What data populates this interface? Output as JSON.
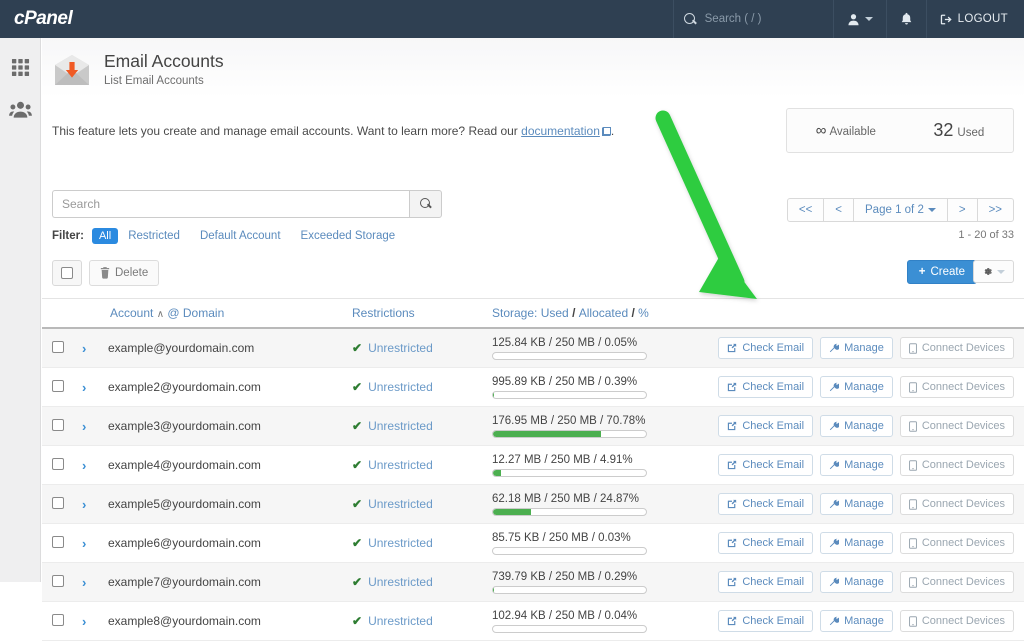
{
  "topbar": {
    "brand": "cPanel",
    "search_placeholder": "Search ( / )",
    "search_value": "",
    "search_icon": "search-icon",
    "user_icon": "user-icon",
    "bell_icon": "bell-icon",
    "logout_label": "LOGOUT",
    "logout_icon": "logout-icon",
    "bg_color": "#2f4052"
  },
  "sidebar": {
    "items": [
      {
        "name": "apps-grid-icon",
        "label": "Apps"
      },
      {
        "name": "users-icon",
        "label": "User Manager"
      }
    ]
  },
  "page": {
    "icon": "email-envelope-icon",
    "title": "Email Accounts",
    "subtitle": "List Email Accounts",
    "intro_prefix": "This feature lets you create and manage email accounts. Want to learn more? Read our ",
    "intro_link": "documentation",
    "intro_suffix": "."
  },
  "quota": {
    "available_value": "∞",
    "available_label": "Available",
    "used_value": "32",
    "used_label": "Used"
  },
  "search": {
    "placeholder": "Search",
    "value": "",
    "button_icon": "search-icon"
  },
  "filter": {
    "label": "Filter:",
    "options": [
      "All",
      "Restricted",
      "Default Account",
      "Exceeded Storage"
    ],
    "active": "All",
    "active_color": "#2b8ae0"
  },
  "pagination": {
    "first_label": "<<",
    "prev_label": "<",
    "page_label": "Page 1 of 2",
    "next_label": ">",
    "last_label": ">>",
    "range_label": "1 - 20 of 33"
  },
  "actionbar": {
    "select_all_name": "select-all-checkbox",
    "delete_label": "Delete",
    "delete_icon": "trash-icon",
    "create_label": "Create",
    "create_icon": "plus-icon",
    "settings_icon": "gear-icon"
  },
  "table": {
    "headers": {
      "account": "Account",
      "sort_caret": "∧",
      "at_domain": "@ Domain",
      "restrictions": "Restrictions",
      "storage_prefix": "Storage:",
      "storage_used": "Used",
      "storage_allocated": "Allocated",
      "storage_percent": "%"
    },
    "action_labels": {
      "check_email": "Check Email",
      "check_email_icon": "external-link-icon",
      "manage": "Manage",
      "manage_icon": "wrench-icon",
      "connect_devices": "Connect Devices",
      "connect_devices_icon": "mobile-icon"
    },
    "restriction_text": "Unrestricted",
    "restriction_icon": "check-icon",
    "rows": [
      {
        "email": "example@yourdomain.com",
        "restriction": "Unrestricted",
        "storage": "125.84 KB / 250 MB / 0.05%",
        "percent": 0.05
      },
      {
        "email": "example2@yourdomain.com",
        "restriction": "Unrestricted",
        "storage": "995.89 KB / 250 MB / 0.39%",
        "percent": 0.39
      },
      {
        "email": "example3@yourdomain.com",
        "restriction": "Unrestricted",
        "storage": "176.95 MB / 250 MB / 70.78%",
        "percent": 70.78
      },
      {
        "email": "example4@yourdomain.com",
        "restriction": "Unrestricted",
        "storage": "12.27 MB / 250 MB / 4.91%",
        "percent": 4.91
      },
      {
        "email": "example5@yourdomain.com",
        "restriction": "Unrestricted",
        "storage": "62.18 MB / 250 MB / 24.87%",
        "percent": 24.87
      },
      {
        "email": "example6@yourdomain.com",
        "restriction": "Unrestricted",
        "storage": "85.75 KB / 250 MB / 0.03%",
        "percent": 0.03
      },
      {
        "email": "example7@yourdomain.com",
        "restriction": "Unrestricted",
        "storage": "739.79 KB / 250 MB / 0.29%",
        "percent": 0.29
      },
      {
        "email": "example8@yourdomain.com",
        "restriction": "Unrestricted",
        "storage": "102.94 KB / 250 MB / 0.04%",
        "percent": 0.04
      }
    ]
  },
  "annotation": {
    "type": "arrow",
    "color": "#2ecc40",
    "points_to": "check-email-button-row-1"
  }
}
